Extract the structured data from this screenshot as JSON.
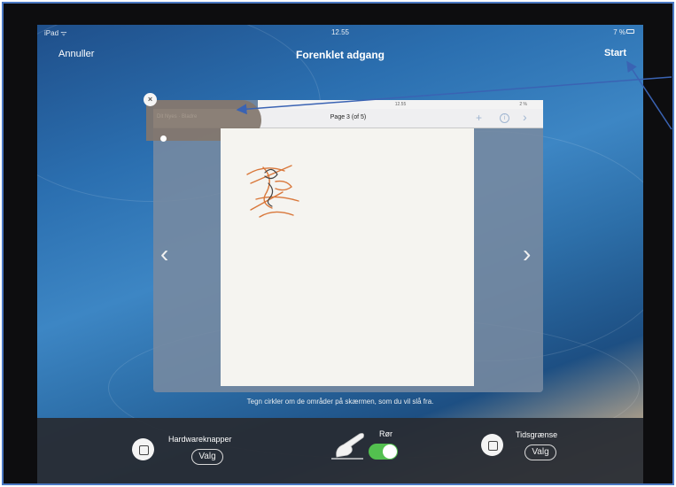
{
  "status_bar": {
    "device": "iPad ᯤ",
    "time": "12.55",
    "battery": "7 %"
  },
  "nav": {
    "cancel_label": "Annuller",
    "title": "Forenklet adgang",
    "start_label": "Start"
  },
  "preview": {
    "status_time": "12.55",
    "status_battery": "2 %",
    "page_title": "Page 3 (of 5)",
    "disabled_text": "Dit Nyes · Bladre",
    "close_icon": "×",
    "plus_icon": "+",
    "info_icon": "i",
    "next_icon": "›",
    "left_chevron": "‹",
    "right_chevron": "›"
  },
  "hint": "Tegn cirkler om de områder på skærmen, som du vil slå fra.",
  "toolbar": {
    "hardware_label": "Hardwareknapper",
    "hardware_option": "Valg",
    "touch_label": "Rør",
    "touch_enabled": true,
    "time_label": "Tidsgrænse",
    "time_option": "Valg"
  },
  "colors": {
    "annotation": "#3a63b3",
    "toggle_on": "#53c04f",
    "sketch": "#d9773a"
  }
}
